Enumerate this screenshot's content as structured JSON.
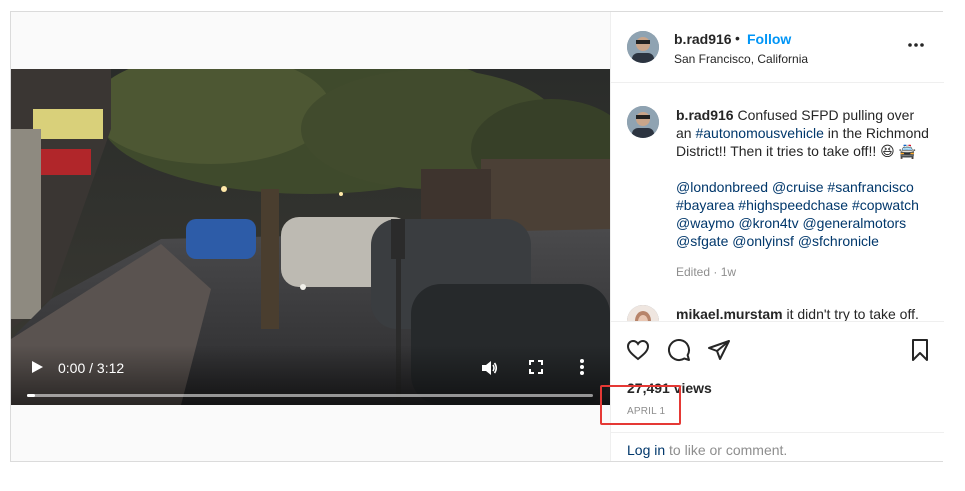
{
  "post": {
    "username": "b.rad916",
    "separator": "•",
    "follow_label": "Follow",
    "location": "San Francisco, California",
    "caption_text": "Confused SFPD pulling over an",
    "caption_hashtag_1": "#autonomousvehicle",
    "caption_text_2": "in the Richmond District!! Then it tries to take off!! 😆 🚔",
    "caption_tags": [
      "@londonbreed",
      "@cruise",
      "#sanfrancisco",
      "#bayarea",
      "#highspeedchase",
      "#copwatch",
      "@waymo",
      "@kron4tv",
      "@generalmotors",
      "@sfgate",
      "@onlyinsf",
      "@sfchronicle"
    ],
    "edited_label": "Edited · 1w",
    "comment": {
      "username": "mikael.murstam",
      "text": "it didn't try to take off."
    },
    "views": "27,491 views",
    "date": "APRIL 1",
    "login_link": "Log in",
    "login_rest": " to like or comment."
  },
  "video": {
    "time_display": "0:00 / 3:12",
    "progress": 0
  },
  "icons": {
    "play": "play-icon",
    "volume": "volume-icon",
    "fullscreen": "fullscreen-icon",
    "more": "more-vertical-icon",
    "options": "more-horizontal-icon",
    "like": "heart-icon",
    "comment": "comment-icon",
    "share": "paper-plane-icon",
    "save": "bookmark-icon"
  },
  "colors": {
    "accent": "#0095f6",
    "link": "#00376b",
    "muted": "#8e8e8e",
    "highlight": "#e53935"
  }
}
